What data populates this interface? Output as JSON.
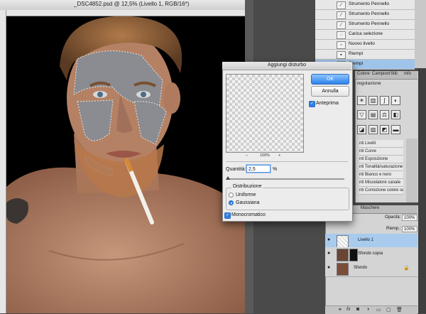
{
  "document": {
    "tab_title": "_DSC4852.psd @ 12,5% (Livello 1, RGB/16*)"
  },
  "history_panel": {
    "items": [
      {
        "label": "Strumento Pennello",
        "icon": "brush-icon"
      },
      {
        "label": "Strumento Pennello",
        "icon": "brush-icon"
      },
      {
        "label": "Strumento Pennello",
        "icon": "brush-icon"
      },
      {
        "label": "Carica selezione",
        "icon": "selection-icon"
      },
      {
        "label": "Nuovo livello",
        "icon": "layer-icon"
      },
      {
        "label": "Riempi",
        "icon": "fill-icon"
      },
      {
        "label": "Riempi",
        "icon": "fill-icon"
      }
    ],
    "selected_index": 6
  },
  "adjustments_panel": {
    "tabs": [
      "Colore",
      "Campioni",
      "Stili",
      "Info"
    ],
    "title": "regolazione",
    "presets": [
      "nti Livelli",
      "nti Curve",
      "nti Esposizione",
      "nti Tonalità/saturazione",
      "nti Bianco e nero",
      "nti Miscelatore canale",
      "nti Correzione colore sel..."
    ]
  },
  "layers_panel": {
    "tabs": [
      "Maschere"
    ],
    "opacity_label": "Opacità:",
    "opacity_value": "100%",
    "fill_label": "Riemp.:",
    "fill_value": "100%",
    "layers": [
      {
        "name": "Livello 1",
        "visible": true,
        "selected": true
      },
      {
        "name": "Sfondo copia",
        "visible": true,
        "selected": false
      },
      {
        "name": "Sfondo",
        "visible": true,
        "selected": false,
        "locked": true
      }
    ],
    "footer_icons": [
      "fx"
    ]
  },
  "dialog": {
    "title": "Aggiungi disturbo",
    "ok_label": "OK",
    "cancel_label": "Annulla",
    "preview_label": "Anteprima",
    "preview_checked": true,
    "zoom_minus": "–",
    "zoom_value": "100%",
    "zoom_plus": "+",
    "amount_label": "Quantità:",
    "amount_value": "2,5",
    "amount_unit": "%",
    "amount_fraction": 0.005,
    "distribution_label": "Distribuzione",
    "distribution_options": [
      "Uniforme",
      "Gaussiana"
    ],
    "distribution_selected": "Gaussiana",
    "monochromatic_label": "Monocromatico",
    "monochromatic_checked": true
  },
  "colors": {
    "accent": "#2d7fe8",
    "selected_row": "#a9cbee",
    "canvas_bg": "#000000",
    "skin": "#b78567",
    "gray_fill": "#8a8c91"
  }
}
